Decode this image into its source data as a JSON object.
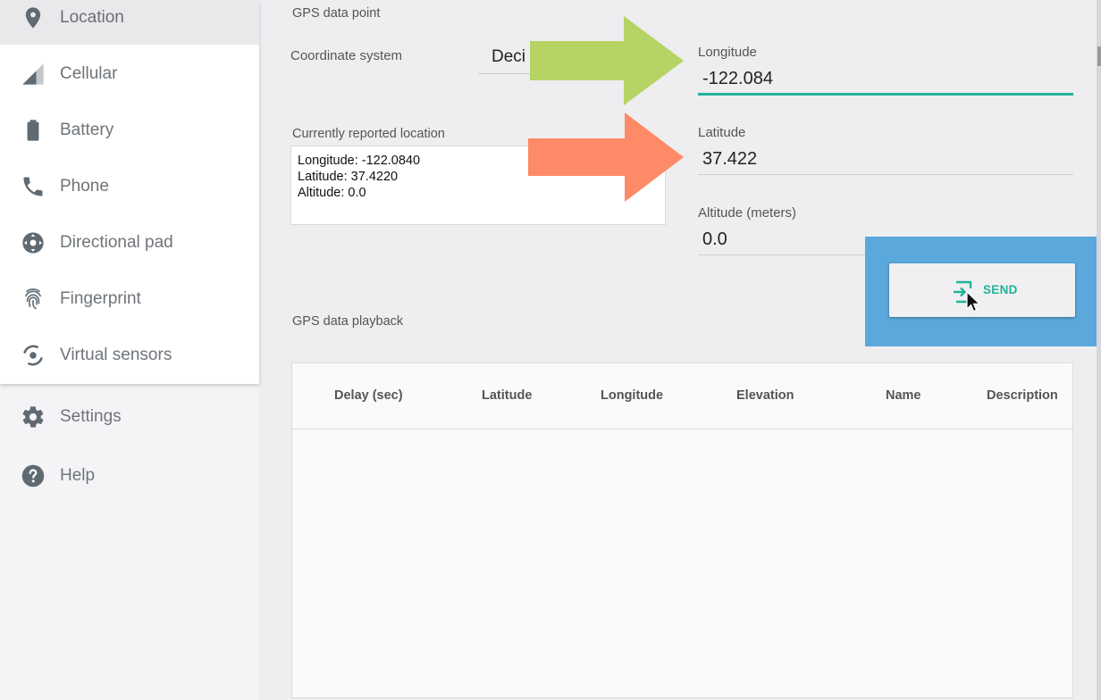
{
  "sidebar": {
    "items": [
      {
        "label": "Location",
        "icon": "location-pin-icon",
        "selected": true
      },
      {
        "label": "Cellular",
        "icon": "cellular-signal-icon"
      },
      {
        "label": "Battery",
        "icon": "battery-icon"
      },
      {
        "label": "Phone",
        "icon": "phone-icon"
      },
      {
        "label": "Directional pad",
        "icon": "dpad-icon"
      },
      {
        "label": "Fingerprint",
        "icon": "fingerprint-icon"
      },
      {
        "label": "Virtual sensors",
        "icon": "virtual-sensors-icon"
      }
    ],
    "footer_items": [
      {
        "label": "Settings",
        "icon": "gear-icon"
      },
      {
        "label": "Help",
        "icon": "help-icon"
      }
    ]
  },
  "gps_point": {
    "section_title": "GPS data point",
    "coordinate_system_label": "Coordinate system",
    "coordinate_system_value": "Deci",
    "reported_title": "Currently reported location",
    "reported_lines": [
      "Longitude: -122.0840",
      "Latitude: 37.4220",
      "Altitude: 0.0"
    ],
    "longitude_label": "Longitude",
    "longitude_value": "-122.084",
    "latitude_label": "Latitude",
    "latitude_value": "37.422",
    "altitude_label": "Altitude (meters)",
    "altitude_value": "0.0",
    "send_label": "SEND"
  },
  "playback": {
    "section_title": "GPS data playback",
    "columns": [
      "Delay (sec)",
      "Latitude",
      "Longitude",
      "Elevation",
      "Name",
      "Description"
    ]
  },
  "colors": {
    "accent": "#20b29a",
    "green_arrow": "#b5d463",
    "orange_arrow": "#fe8a68",
    "highlight": "#5aa8dc"
  }
}
